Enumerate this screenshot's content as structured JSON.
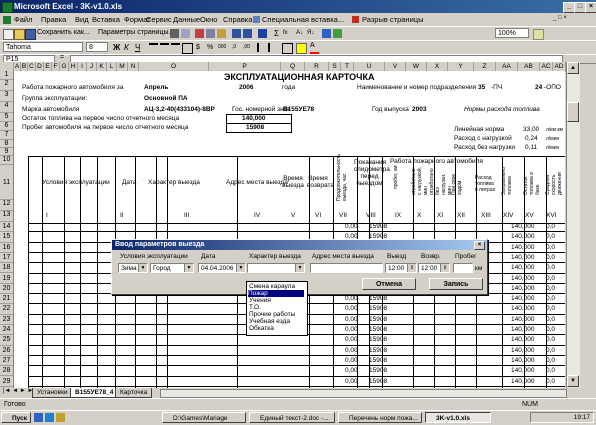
{
  "window": {
    "title": "Microsoft Excel - 3K-v1.0.xls"
  },
  "menu": [
    "Файл",
    "Правка",
    "Вид",
    "Вставка",
    "Формат",
    "Сервис",
    "Данные",
    "Окно",
    "Справка",
    "Специальная вставка...",
    "Разрыв страницы"
  ],
  "toolbar": {
    "save_as": "Сохранить как...",
    "page_params": "Параметры страницы...",
    "zoom": "100%"
  },
  "format_bar": {
    "font": "Tahoma",
    "size": "8"
  },
  "formula_bar": {
    "name_box": "P15",
    "fx": "="
  },
  "columns": [
    "A",
    "B",
    "C",
    "D",
    "E",
    "F",
    "G",
    "H",
    "I",
    "J",
    "K",
    "L",
    "M",
    "N",
    "O",
    "P",
    "Q",
    "R",
    "S",
    "T",
    "U",
    "V",
    "W",
    "X",
    "Y",
    "Z",
    "AA",
    "AB",
    "AC",
    "AD"
  ],
  "rows": [
    "1",
    "2",
    "3",
    "4",
    "5",
    "6",
    "7",
    "8",
    "9",
    "10",
    "11",
    "12",
    "13",
    "14",
    "15",
    "16",
    "17",
    "18",
    "19",
    "20",
    "21",
    "22",
    "23",
    "24",
    "25",
    "26",
    "27",
    "28",
    "29"
  ],
  "sheet": {
    "title": "ЭКСПЛУАТАЦИОННАЯ КАРТОЧКА",
    "row2": {
      "label": "Работа пожарного автомобиля за",
      "month": "Апрель",
      "year": "2006",
      "year_suffix": "года",
      "unit_label": "Наименование и номер подразделения",
      "unit_num": "35",
      "unit_suffix": "-ПЧ",
      "opo_num": "24",
      "opo_suffix": "-ОПО"
    },
    "row3": {
      "label": "Группа эксплуатации:",
      "value": "Основной ПА"
    },
    "row4": {
      "label": "Марка автомобиля",
      "value": "АЦ-3,2-40(433104)-8ВР",
      "gos_label": "Гос. номерной знак",
      "gos_value": "В155УЕ78",
      "year_label": "Год выпуска",
      "year_value": "2003",
      "norms": "Нормы расхода топлива"
    },
    "row5": {
      "label": "Остаток топлива на первое число отчетного месяца",
      "value": "140,000",
      "norm_label": "Линейная норма",
      "norm_value": "33,00",
      "norm_unit": "л/км км"
    },
    "row6": {
      "label": "Пробег автомобиля на первое число отчетного месяца",
      "value": "15908",
      "cargo_label": "Расход с нагрузкой",
      "cargo_value": "0,24",
      "cargo_unit": "л/мин"
    },
    "row7": {
      "noload_label": "Расход без нагрузки",
      "noload_value": "0,11",
      "noload_unit": "л/мин"
    },
    "headers": {
      "usloviya": "Условия эксплуатации",
      "data": "Дата",
      "harakter": "Характер выезда",
      "adres": "Адрес места выезда",
      "vremya_v": "Время выезда",
      "vremya_voz": "Время возврата",
      "prod": "Продолжительность выезда, час",
      "pokazaniya": "Показания спидометра перед выездом",
      "rabota": "Работа пожарного автомобиля",
      "probeg": "пробег, км",
      "otpr_nag": "отработано с нагрузкой, мин",
      "otpr_bez": "отработано без нагрузки, мин",
      "pri_sp": "При свое ходом",
      "rashod": "Расход топлива в литрах",
      "zapr": "Заправлено топлива",
      "ostatok": "Остаток топлива в баке",
      "sredn": "Средняя скорость движения"
    },
    "roman": [
      "I",
      "II",
      "III",
      "IV",
      "V",
      "VI",
      "VII",
      "VIII",
      "IX",
      "X",
      "XI",
      "XII",
      "XIII",
      "XIV",
      "XV",
      "XVI"
    ],
    "rows": [
      {
        "n": "14",
        "w": "0,00",
        "x": "15908",
        "ab": "140,000",
        "ad": "0,0"
      },
      {
        "n": "15",
        "w": "0,00",
        "x": "15908",
        "ab": "140,000",
        "ad": "0,0"
      },
      {
        "n": "16",
        "w": "0,00",
        "x": "15908",
        "ab": "140,000",
        "ad": "0,0"
      },
      {
        "n": "17",
        "w": "0,00",
        "x": "15908",
        "ab": "140,000",
        "ad": "0,0"
      },
      {
        "n": "18",
        "w": "0,00",
        "x": "15908",
        "ab": "140,000",
        "ad": "0,0"
      },
      {
        "n": "19",
        "w": "0,00",
        "x": "15908",
        "ab": "140,000",
        "ad": "0,0"
      },
      {
        "n": "20",
        "w": "0,00",
        "x": "15908",
        "ab": "140,000",
        "ad": "0,0"
      },
      {
        "n": "21",
        "w": "0,00",
        "x": "15908",
        "ab": "140,000",
        "ad": "0,0"
      },
      {
        "n": "22",
        "w": "0,00",
        "x": "15908",
        "ab": "140,000",
        "ad": "0,0"
      },
      {
        "n": "23",
        "w": "0,00",
        "x": "15908",
        "ab": "140,000",
        "ad": "0,0"
      },
      {
        "n": "24",
        "w": "0,00",
        "x": "15908",
        "ab": "140,000",
        "ad": "0,0"
      },
      {
        "n": "25",
        "w": "0,00",
        "x": "15908",
        "ab": "140,000",
        "ad": "0,0"
      },
      {
        "n": "26",
        "w": "0,00",
        "x": "15908",
        "ab": "140,000",
        "ad": "0,0"
      },
      {
        "n": "27",
        "w": "0,00",
        "x": "15908",
        "ab": "140,000",
        "ad": "0,0"
      },
      {
        "n": "28",
        "w": "0,00",
        "x": "15908",
        "ab": "140,000",
        "ad": "0,0"
      },
      {
        "n": "29",
        "w": "0,00",
        "x": "15908",
        "ab": "140,000",
        "ad": "0,0"
      }
    ]
  },
  "dialog": {
    "title": "Ввод параметров выезда",
    "labels": {
      "usloviya": "Условия эксплуатации",
      "data": "Дата",
      "harakter": "Характер выезда",
      "adres": "Адрес места выезда",
      "vyezd": "Выезд",
      "vozvr": "Возвр.",
      "probeg": "Пробег",
      "km": "км"
    },
    "values": {
      "zima": "Зима",
      "gorod": "Город",
      "date": "04.04.2006",
      "harakter": "",
      "adres": "",
      "vyezd": "12:00",
      "vozvr": "12:00",
      "probeg": ""
    },
    "buttons": {
      "cancel": "Отмена",
      "save": "Запись"
    },
    "dropdown": [
      "Смена караула",
      "Пожар",
      "Учения",
      "Т.О.",
      "Прочие работы",
      "Учебная езда",
      "Обкатка"
    ],
    "dropdown_selected": 1
  },
  "tabs": {
    "tab1": "Установки",
    "tab2": "В155УЕ78_4",
    "tab3": "Карточка"
  },
  "status": {
    "ready": "Готово",
    "num": "NUM"
  },
  "taskbar": {
    "start": "Пуск",
    "items": [
      "D:\\Games\\Mariage",
      "Единый текст-2.doc -...",
      "Перечень норм пожа...",
      "3K-v1.0.xls"
    ],
    "time": "19:17"
  },
  "colors": {
    "title": "#0a246a",
    "selection": "#000080",
    "sheet": "#ffffff"
  }
}
